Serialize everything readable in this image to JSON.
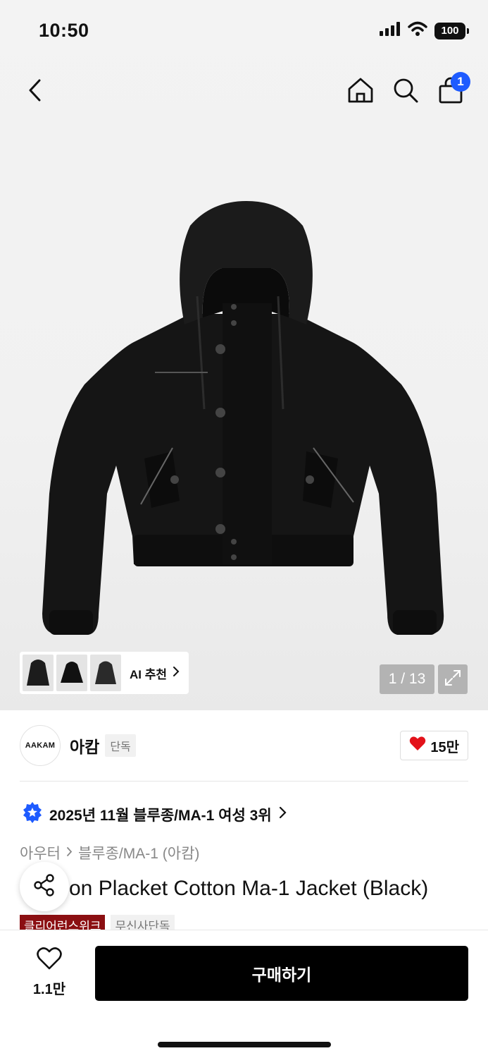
{
  "status_bar": {
    "time": "10:50",
    "battery": "100"
  },
  "header": {
    "cart_count": "1"
  },
  "gallery": {
    "ai_recommend": "AI 추천",
    "page_counter": "1 / 13"
  },
  "brand": {
    "logo_text": "AAKAM",
    "name": "아캄",
    "badge": "단독",
    "likes": "15만"
  },
  "ranking": {
    "text": "2025년 11월 블루종/MA-1 여성 3위"
  },
  "breadcrumb": {
    "category": "아우터",
    "subcategory": "블루종/MA-1 (아캄)"
  },
  "product": {
    "title_visible": "on Placket Cotton Ma-1 Jacket (Black)"
  },
  "tags": [
    "클리어런스위크",
    "무신사단독"
  ],
  "bottom_bar": {
    "wish_count": "1.1만",
    "buy_label": "구매하기"
  },
  "colors": {
    "accent_blue": "#1e5bff",
    "heart_red": "#e3121a",
    "tag_red": "#8b0f12",
    "buy_black": "#000000"
  }
}
